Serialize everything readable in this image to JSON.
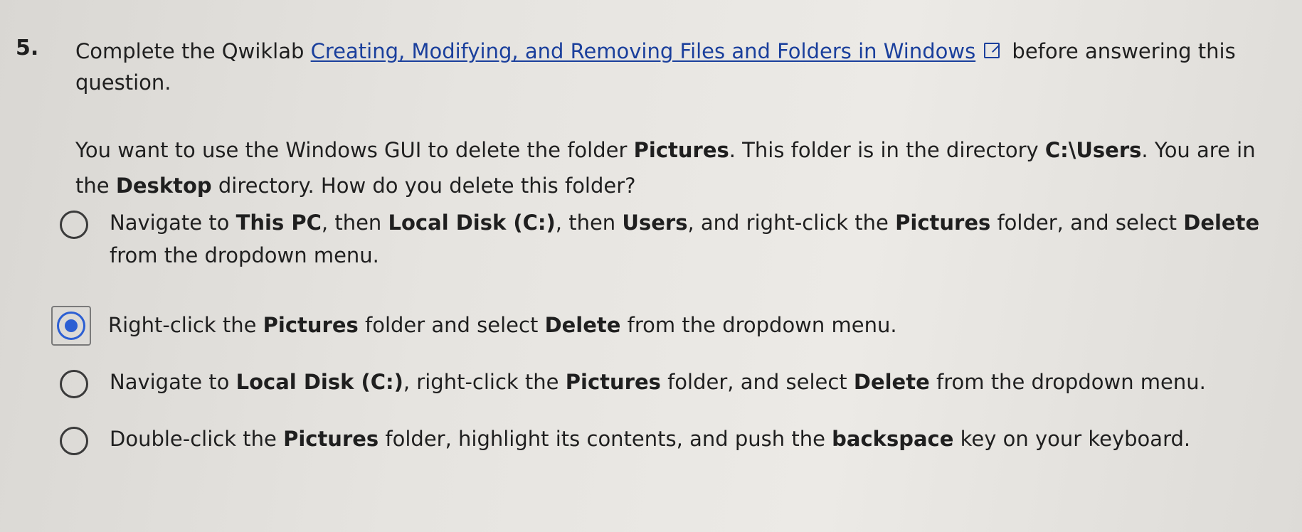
{
  "question": {
    "number": "5.",
    "intro_prefix": "Complete the Qwiklab ",
    "lab_link": "Creating, Modifying, and Removing Files and Folders in Windows",
    "intro_suffix": " before answering this question.",
    "body_1": "You want to use the Windows GUI to delete the folder ",
    "body_pictures": "Pictures",
    "body_2": ". This folder is in the directory ",
    "body_path": "C:\\Users",
    "body_3": ". You are in the ",
    "body_desktop": "Desktop",
    "body_4": " directory. How do you delete this folder?"
  },
  "options": [
    {
      "selected": false,
      "parts": [
        {
          "t": "Navigate to ",
          "b": false
        },
        {
          "t": "This PC",
          "b": true
        },
        {
          "t": ", then ",
          "b": false
        },
        {
          "t": "Local Disk (C:)",
          "b": true
        },
        {
          "t": ", then ",
          "b": false
        },
        {
          "t": "Users",
          "b": true
        },
        {
          "t": ", and right-click the ",
          "b": false
        },
        {
          "t": "Pictures",
          "b": true
        },
        {
          "t": " folder, and select ",
          "b": false
        },
        {
          "t": "Delete",
          "b": true
        },
        {
          "t": " from the dropdown menu.",
          "b": false
        }
      ]
    },
    {
      "selected": true,
      "parts": [
        {
          "t": "Right-click the ",
          "b": false
        },
        {
          "t": "Pictures",
          "b": true
        },
        {
          "t": " folder and select ",
          "b": false
        },
        {
          "t": "Delete",
          "b": true
        },
        {
          "t": " from the dropdown menu.",
          "b": false
        }
      ]
    },
    {
      "selected": false,
      "parts": [
        {
          "t": "Navigate to ",
          "b": false
        },
        {
          "t": "Local Disk (C:)",
          "b": true
        },
        {
          "t": ", right-click the ",
          "b": false
        },
        {
          "t": "Pictures",
          "b": true
        },
        {
          "t": " folder, and select ",
          "b": false
        },
        {
          "t": "Delete",
          "b": true
        },
        {
          "t": " from the dropdown menu.",
          "b": false
        }
      ]
    },
    {
      "selected": false,
      "parts": [
        {
          "t": "Double-click the ",
          "b": false
        },
        {
          "t": "Pictures",
          "b": true
        },
        {
          "t": " folder, highlight its contents, and push the ",
          "b": false
        },
        {
          "t": "backspace",
          "b": true
        },
        {
          "t": " key on your keyboard.",
          "b": false
        }
      ]
    }
  ],
  "colors": {
    "link": "#1a3f9c",
    "selected_radio": "#2c5fd3"
  },
  "icons": {
    "external_link": "external-link-icon",
    "radio_selected": "radio-selected-icon",
    "radio_unselected": "radio-unselected-icon"
  }
}
